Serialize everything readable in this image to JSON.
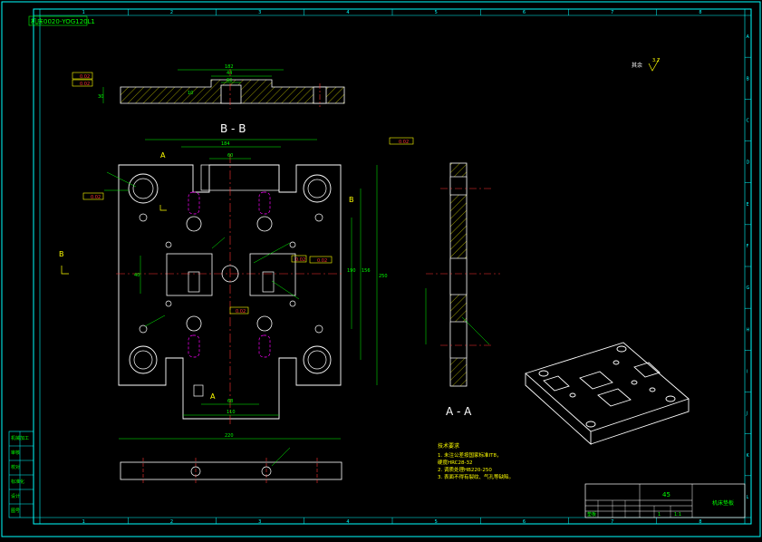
{
  "sheet": {
    "title_tag": "机床0020-YOG120L1",
    "col_labels": [
      "1",
      "2",
      "3",
      "4",
      "5",
      "6",
      "7",
      "8"
    ],
    "row_labels": [
      "A",
      "B",
      "C",
      "D",
      "E",
      "F",
      "G",
      "H",
      "I",
      "J",
      "K",
      "L"
    ]
  },
  "views": {
    "section_bb": "B - B",
    "section_aa": "A - A",
    "mark_a_top": "A",
    "mark_a_bottom": "A",
    "mark_b_left": "B",
    "mark_b_right": "B"
  },
  "dims": {
    "top_width": "182",
    "top_inner": "60",
    "top_mid": "44",
    "top_h1": "30",
    "top_h2": "10",
    "overall_width": "220",
    "inner_width": "184",
    "slot_width": "60",
    "bottom_inner": "110",
    "bottom_slot": "68",
    "height_main": "250",
    "height_inner": "190",
    "height_inner2": "156",
    "side_dim": "40"
  },
  "tolerance_frames": {
    "top1": "0.02",
    "top2": "0.02",
    "right_top": "0.02",
    "left_mid": "0.02",
    "center": "0.02",
    "center2": "0.02",
    "mid_bottom": "0.02"
  },
  "roughness": {
    "label": "其余",
    "value": "3.2"
  },
  "notes": {
    "title": "技术要求",
    "items": [
      "1. 未注公差按国家标准IT8，",
      "   硬度HRC28-32",
      "2. 调质处理HB220-250",
      "3. 表面不得有裂纹、气孔等缺陷。"
    ]
  },
  "title_block": {
    "part_name": "垫板",
    "material": "45",
    "drawing_no": "机床垫板",
    "scale": "1:1",
    "sheet": "1"
  },
  "left_table": {
    "rows": [
      "机械加工",
      "审核",
      "校对",
      "标准化",
      "设计",
      "图号"
    ]
  },
  "colors": {
    "border": "#00ffff",
    "outline": "#ffffff",
    "center_line": "#ff3333",
    "dimension": "#00ff00",
    "hidden": "#ff00ff",
    "label": "#ffff00",
    "frame": "#ffff00"
  }
}
